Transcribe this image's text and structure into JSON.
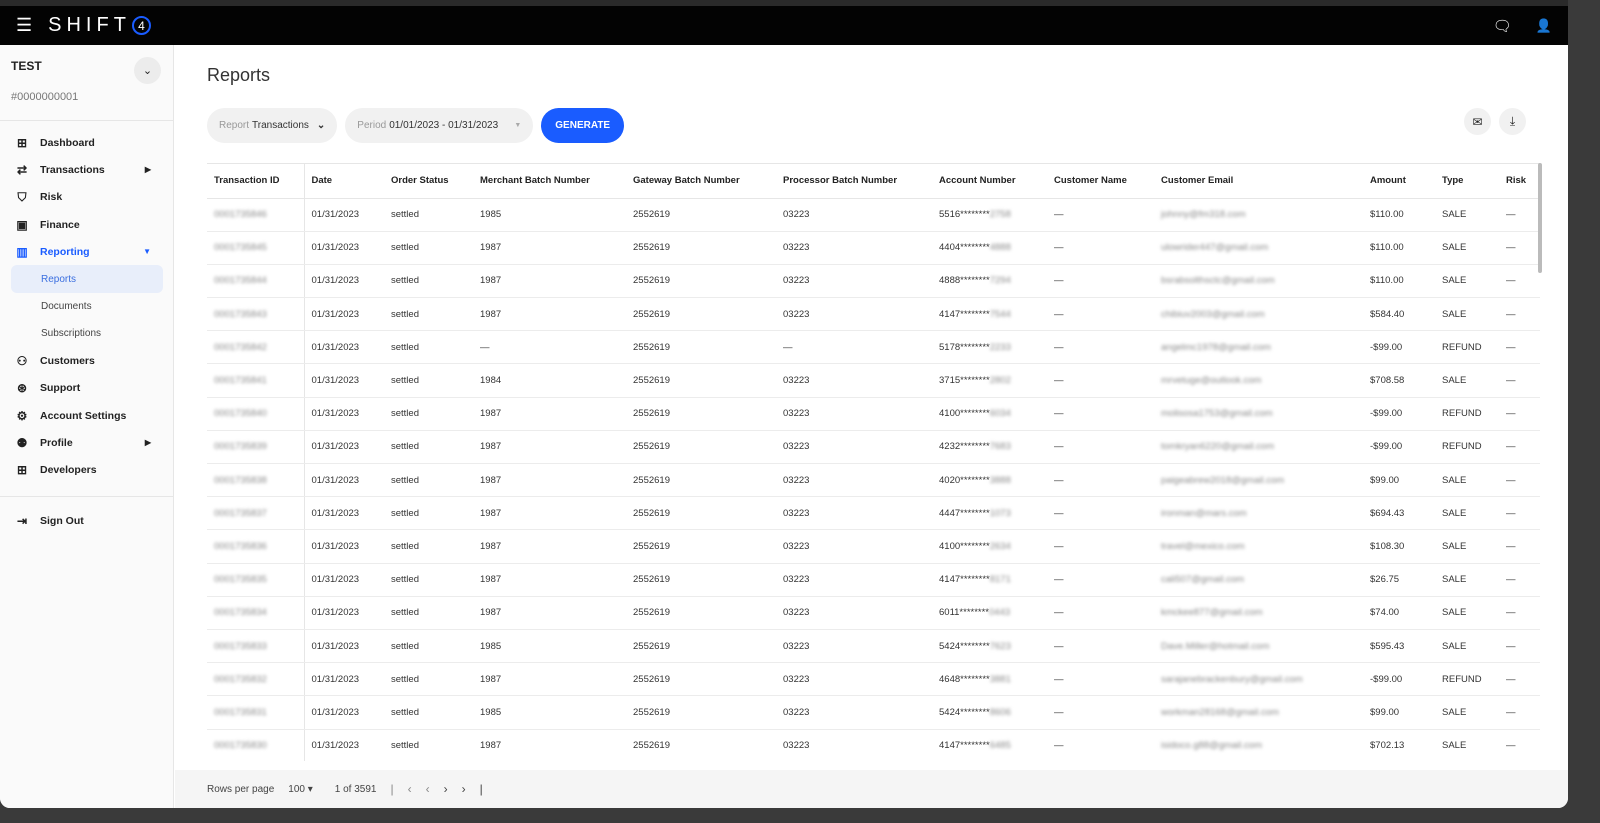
{
  "header": {
    "logo": "SHIFT",
    "logo_mark": "4",
    "menu_icon": "menu-icon",
    "chat_icon": "chat-icon",
    "user_icon": "user-icon"
  },
  "account": {
    "name": "TEST",
    "number": "#0000000001"
  },
  "sidebar": {
    "items": [
      {
        "label": "Dashboard",
        "icon": "grid-icon",
        "glyph": "⊞"
      },
      {
        "label": "Transactions",
        "icon": "arrows-icon",
        "glyph": "⇄",
        "arrow": "▶"
      },
      {
        "label": "Risk",
        "icon": "shield-icon",
        "glyph": "⛉"
      },
      {
        "label": "Finance",
        "icon": "wallet-icon",
        "glyph": "▣"
      },
      {
        "label": "Reporting",
        "icon": "chart-icon",
        "glyph": "▥",
        "arrow": "▼",
        "active": true
      },
      {
        "label": "Customers",
        "icon": "customers-icon",
        "glyph": "⚇"
      },
      {
        "label": "Support",
        "icon": "support-icon",
        "glyph": "⊛"
      },
      {
        "label": "Account Settings",
        "icon": "gear-icon",
        "glyph": "⚙"
      },
      {
        "label": "Profile",
        "icon": "profile-icon",
        "glyph": "⚉",
        "arrow": "▶"
      },
      {
        "label": "Developers",
        "icon": "grid-icon",
        "glyph": "⊞"
      }
    ],
    "subitems": [
      "Reports",
      "Documents",
      "Subscriptions"
    ],
    "signout": "Sign Out"
  },
  "main": {
    "title": "Reports",
    "report_label": "Report",
    "report_value": "Transactions",
    "period_label": "Period",
    "period_value": "01/01/2023 - 01/31/2023",
    "generate": "GENERATE"
  },
  "table": {
    "columns": [
      "Transaction ID",
      "Date",
      "Order Status",
      "Merchant Batch Number",
      "Gateway Batch Number",
      "Processor Batch Number",
      "Account Number",
      "Customer Name",
      "Customer Email",
      "Amount",
      "Type",
      "Risk"
    ],
    "rows": [
      [
        "0001735846",
        "01/31/2023",
        "settled",
        "1985",
        "2552619",
        "03223",
        "5516********",
        "2758",
        "—",
        "johnny@fm318.com",
        "$110.00",
        "SALE",
        "—"
      ],
      [
        "0001735845",
        "01/31/2023",
        "settled",
        "1987",
        "2552619",
        "03223",
        "4404********",
        "4888",
        "—",
        "ulowrider447@gmail.com",
        "$110.00",
        "SALE",
        "—"
      ],
      [
        "0001735844",
        "01/31/2023",
        "settled",
        "1987",
        "2552619",
        "03223",
        "4888********",
        "7294",
        "—",
        "bsrabsolthsctc@gmail.com",
        "$110.00",
        "SALE",
        "—"
      ],
      [
        "0001735843",
        "01/31/2023",
        "settled",
        "1987",
        "2552619",
        "03223",
        "4147********",
        "7544",
        "—",
        "chibiuv2003@gmail.com",
        "$584.40",
        "SALE",
        "—"
      ],
      [
        "0001735842",
        "01/31/2023",
        "settled",
        "—",
        "2552619",
        "—",
        "5178********",
        "2233",
        "—",
        "angelmc1978@gmail.com",
        "-$99.00",
        "REFUND",
        "—"
      ],
      [
        "0001735841",
        "01/31/2023",
        "settled",
        "1984",
        "2552619",
        "03223",
        "3715********",
        "2802",
        "—",
        "mrvetuge@outlook.com",
        "$708.58",
        "SALE",
        "—"
      ],
      [
        "0001735840",
        "01/31/2023",
        "settled",
        "1987",
        "2552619",
        "03223",
        "4100********",
        "6034",
        "—",
        "molisosa1753@gmail.com",
        "-$99.00",
        "REFUND",
        "—"
      ],
      [
        "0001735839",
        "01/31/2023",
        "settled",
        "1987",
        "2552619",
        "03223",
        "4232********",
        "7683",
        "—",
        "tomkryan6220@gmail.com",
        "-$99.00",
        "REFUND",
        "—"
      ],
      [
        "0001735838",
        "01/31/2023",
        "settled",
        "1987",
        "2552619",
        "03223",
        "4020********",
        "3888",
        "—",
        "paigeabrew2018@gmail.com",
        "$99.00",
        "SALE",
        "—"
      ],
      [
        "0001735837",
        "01/31/2023",
        "settled",
        "1987",
        "2552619",
        "03223",
        "4447********",
        "1073",
        "—",
        "ironman@mars.com",
        "$694.43",
        "SALE",
        "—"
      ],
      [
        "0001735836",
        "01/31/2023",
        "settled",
        "1987",
        "2552619",
        "03223",
        "4100********",
        "2634",
        "—",
        "travel@mexico.com",
        "$108.30",
        "SALE",
        "—"
      ],
      [
        "0001735835",
        "01/31/2023",
        "settled",
        "1987",
        "2552619",
        "03223",
        "4147********",
        "8171",
        "—",
        "cali507@gmail.com",
        "$26.75",
        "SALE",
        "—"
      ],
      [
        "0001735834",
        "01/31/2023",
        "settled",
        "1987",
        "2552619",
        "03223",
        "6011********",
        "0443",
        "—",
        "kmckee877@gmail.com",
        "$74.00",
        "SALE",
        "—"
      ],
      [
        "0001735833",
        "01/31/2023",
        "settled",
        "1985",
        "2552619",
        "03223",
        "5424********",
        "7623",
        "—",
        "Dave.Miller@hotmail.com",
        "$595.43",
        "SALE",
        "—"
      ],
      [
        "0001735832",
        "01/31/2023",
        "settled",
        "1987",
        "2552619",
        "03223",
        "4648********",
        "3881",
        "—",
        "sarajanebrackenbury@gmail.com",
        "-$99.00",
        "REFUND",
        "—"
      ],
      [
        "0001735831",
        "01/31/2023",
        "settled",
        "1985",
        "2552619",
        "03223",
        "5424********",
        "8606",
        "—",
        "workman28168@gmail.com",
        "$99.00",
        "SALE",
        "—"
      ],
      [
        "0001735830",
        "01/31/2023",
        "settled",
        "1987",
        "2552619",
        "03223",
        "4147********",
        "6485",
        "—",
        "isidoco.g88@gmail.com",
        "$702.13",
        "SALE",
        "—"
      ]
    ]
  },
  "footer": {
    "rows_per_page_label": "Rows per page",
    "rows_per_page": "100 ▾",
    "page_info": "1 of 3591"
  },
  "colors": {
    "accent": "#1a5cff",
    "topbar": "#030303"
  }
}
